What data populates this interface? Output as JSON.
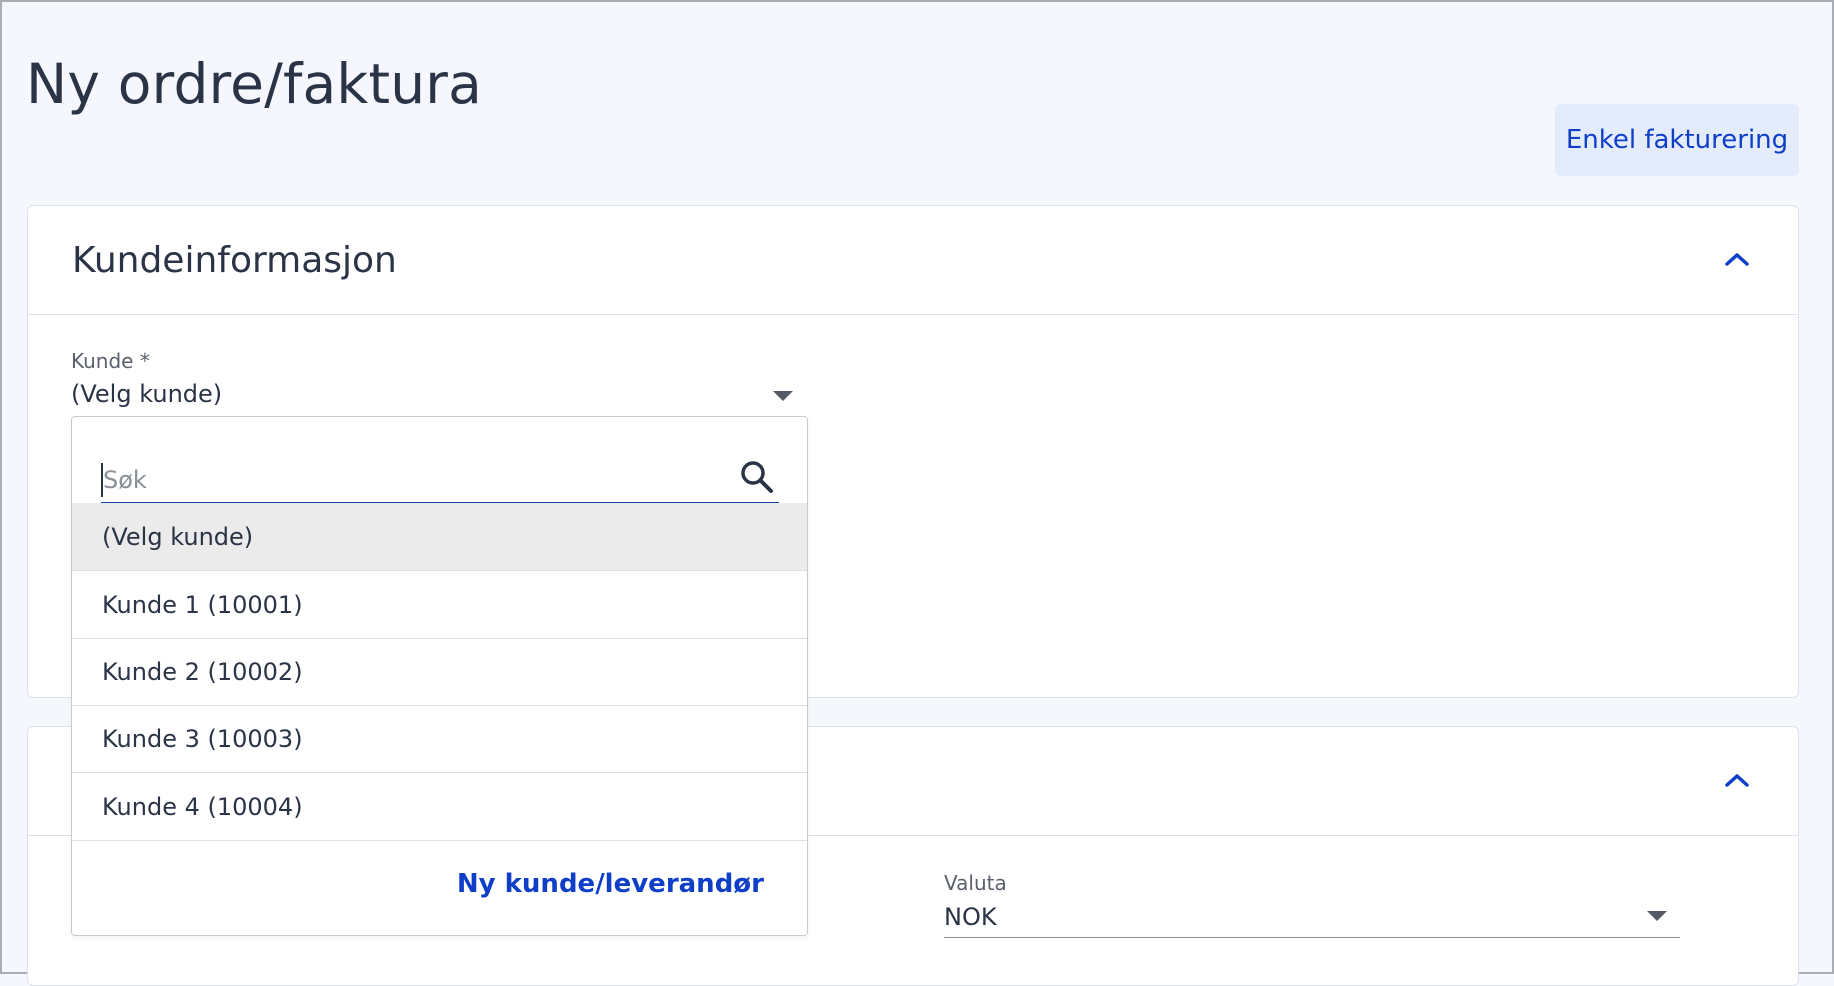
{
  "page": {
    "title": "Ny ordre/faktura"
  },
  "header": {
    "simple_invoicing_label": "Enkel fakturering"
  },
  "customer_section": {
    "title": "Kundeinformasjon",
    "customer_field": {
      "label": "Kunde *",
      "value": "(Velg kunde)"
    }
  },
  "dropdown": {
    "search_placeholder": "Søk",
    "options": [
      {
        "label": "(Velg kunde)",
        "selected": true
      },
      {
        "label": "Kunde 1 (10001)"
      },
      {
        "label": "Kunde 2 (10002)"
      },
      {
        "label": "Kunde 3 (10003)"
      },
      {
        "label": "Kunde 4 (10004)"
      }
    ],
    "new_link_label": "Ny kunde/leverandør"
  },
  "second_section": {
    "currency_field": {
      "label": "Valuta",
      "value": "NOK"
    }
  },
  "colors": {
    "accent": "#0f3fc9",
    "focus_underline": "#173aa6",
    "selected_bg": "#ebebeb"
  },
  "icons": {
    "collapse": "chevron-up-icon",
    "search": "search-icon",
    "dropdown": "caret-down-icon"
  }
}
